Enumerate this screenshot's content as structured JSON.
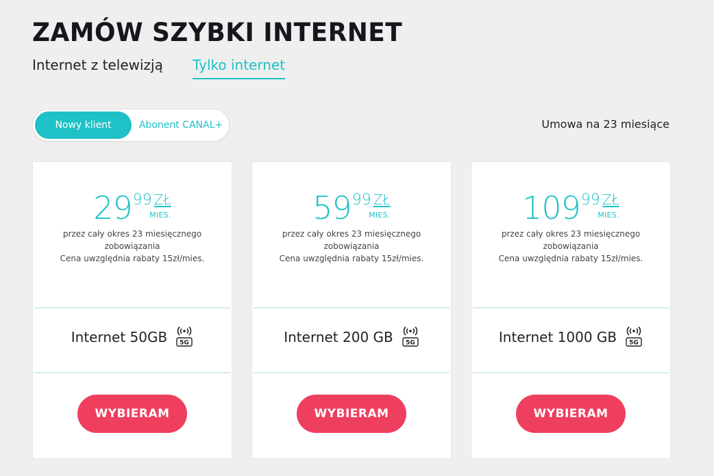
{
  "header": {
    "title": "ZAMÓW SZYBKI INTERNET",
    "tabs": [
      {
        "label": "Internet z telewizją",
        "active": false
      },
      {
        "label": "Tylko internet",
        "active": true
      }
    ]
  },
  "client_toggle": {
    "options": [
      "Nowy klient",
      "Abonent CANAL+"
    ],
    "selected": "Nowy klient"
  },
  "contract_label": "Umowa na 23 miesiące",
  "colors": {
    "accent": "#1ec1c6",
    "cta": "#ee3f5e",
    "background": "#efefef"
  },
  "cards": [
    {
      "price_int": "29",
      "price_dec": "99",
      "currency": "ZŁ",
      "period": "MIES.",
      "desc_lines": [
        "przez cały okres 23 miesięcznego",
        "zobowiązania",
        "Cena uwzględnia rabaty 15zł/mies."
      ],
      "plan": "Internet 50GB",
      "badge": "5G",
      "icon": "5g-signal-icon",
      "cta": "WYBIERAM"
    },
    {
      "price_int": "59",
      "price_dec": "99",
      "currency": "ZŁ",
      "period": "MIES.",
      "desc_lines": [
        "przez cały okres 23 miesięcznego",
        "zobowiązania",
        "Cena uwzględnia rabaty 15zł/mies."
      ],
      "plan": "Internet 200 GB",
      "badge": "5G",
      "icon": "5g-signal-icon",
      "cta": "WYBIERAM"
    },
    {
      "price_int": "109",
      "price_dec": "99",
      "currency": "ZŁ",
      "period": "MIES.",
      "desc_lines": [
        "przez cały okres 23 miesięcznego",
        "zobowiązania",
        "Cena uwzględnia rabaty 15zł/mies."
      ],
      "plan": "Internet 1000 GB",
      "badge": "5G",
      "icon": "5g-signal-icon",
      "cta": "WYBIERAM"
    }
  ]
}
